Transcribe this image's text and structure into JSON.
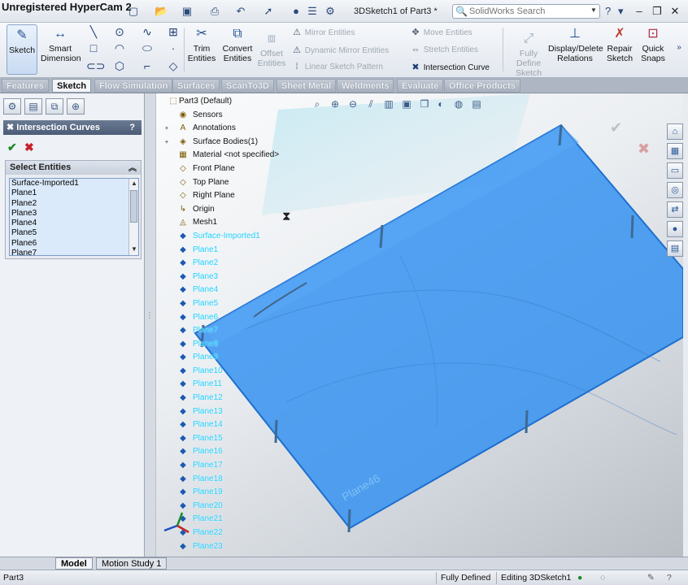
{
  "window": {
    "recorder_title": "Unregistered HyperCam 2",
    "doc_title": "3DSketch1 of Part3 *",
    "search_placeholder": "SolidWorks Search"
  },
  "ribbon": {
    "sketch": "Sketch",
    "smart_dimension": "Smart Dimension",
    "trim": "Trim Entities",
    "convert": "Convert Entities",
    "offset": "Offset Entities",
    "mirror": "Mirror Entities",
    "dynamic_mirror": "Dynamic Mirror Entities",
    "linear_pattern": "Linear Sketch Pattern",
    "move": "Move Entities",
    "stretch": "Stretch Entities",
    "intersection_curve": "Intersection Curve",
    "fully_define": "Fully Define Sketch",
    "display_delete": "Display/Delete Relations",
    "repair": "Repair Sketch",
    "quick_snaps": "Quick Snaps"
  },
  "tabs": [
    "Features",
    "Sketch",
    "Flow Simulation",
    "Surfaces",
    "ScanTo3D",
    "Sheet Metal",
    "Weldments",
    "Evaluate",
    "Office Products"
  ],
  "property_manager": {
    "title": "Intersection Curves",
    "help": "?",
    "select_group": "Select Entities",
    "entities": [
      "Surface-Imported1",
      "Plane1",
      "Plane2",
      "Plane3",
      "Plane4",
      "Plane5",
      "Plane6",
      "Plane7"
    ]
  },
  "tree": {
    "root": "Part3  (Default)",
    "items": [
      "Sensors",
      "Annotations",
      "Surface Bodies(1)",
      "Material <not specified>",
      "Front Plane",
      "Top Plane",
      "Right Plane",
      "Origin",
      "Mesh1"
    ],
    "planes": [
      "Surface-Imported1",
      "Plane1",
      "Plane2",
      "Plane3",
      "Plane4",
      "Plane5",
      "Plane6",
      "Plane7",
      "Plane8",
      "Plane9",
      "Plane10",
      "Plane11",
      "Plane12",
      "Plane13",
      "Plane14",
      "Plane15",
      "Plane16",
      "Plane17",
      "Plane18",
      "Plane19",
      "Plane20",
      "Plane21",
      "Plane22",
      "Plane23"
    ]
  },
  "viewport": {
    "plane_label": "Plane46"
  },
  "bottom_tabs": [
    "Model",
    "Motion Study 1"
  ],
  "status": {
    "part": "Part3",
    "defined": "Fully Defined",
    "editing": "Editing 3DSketch1"
  },
  "colors": {
    "surface_blue": "#2f8ff0",
    "tree_plane_text": "#1ed0ff",
    "accept_green": "#1e8a2a",
    "cancel_red": "#c8202a"
  }
}
